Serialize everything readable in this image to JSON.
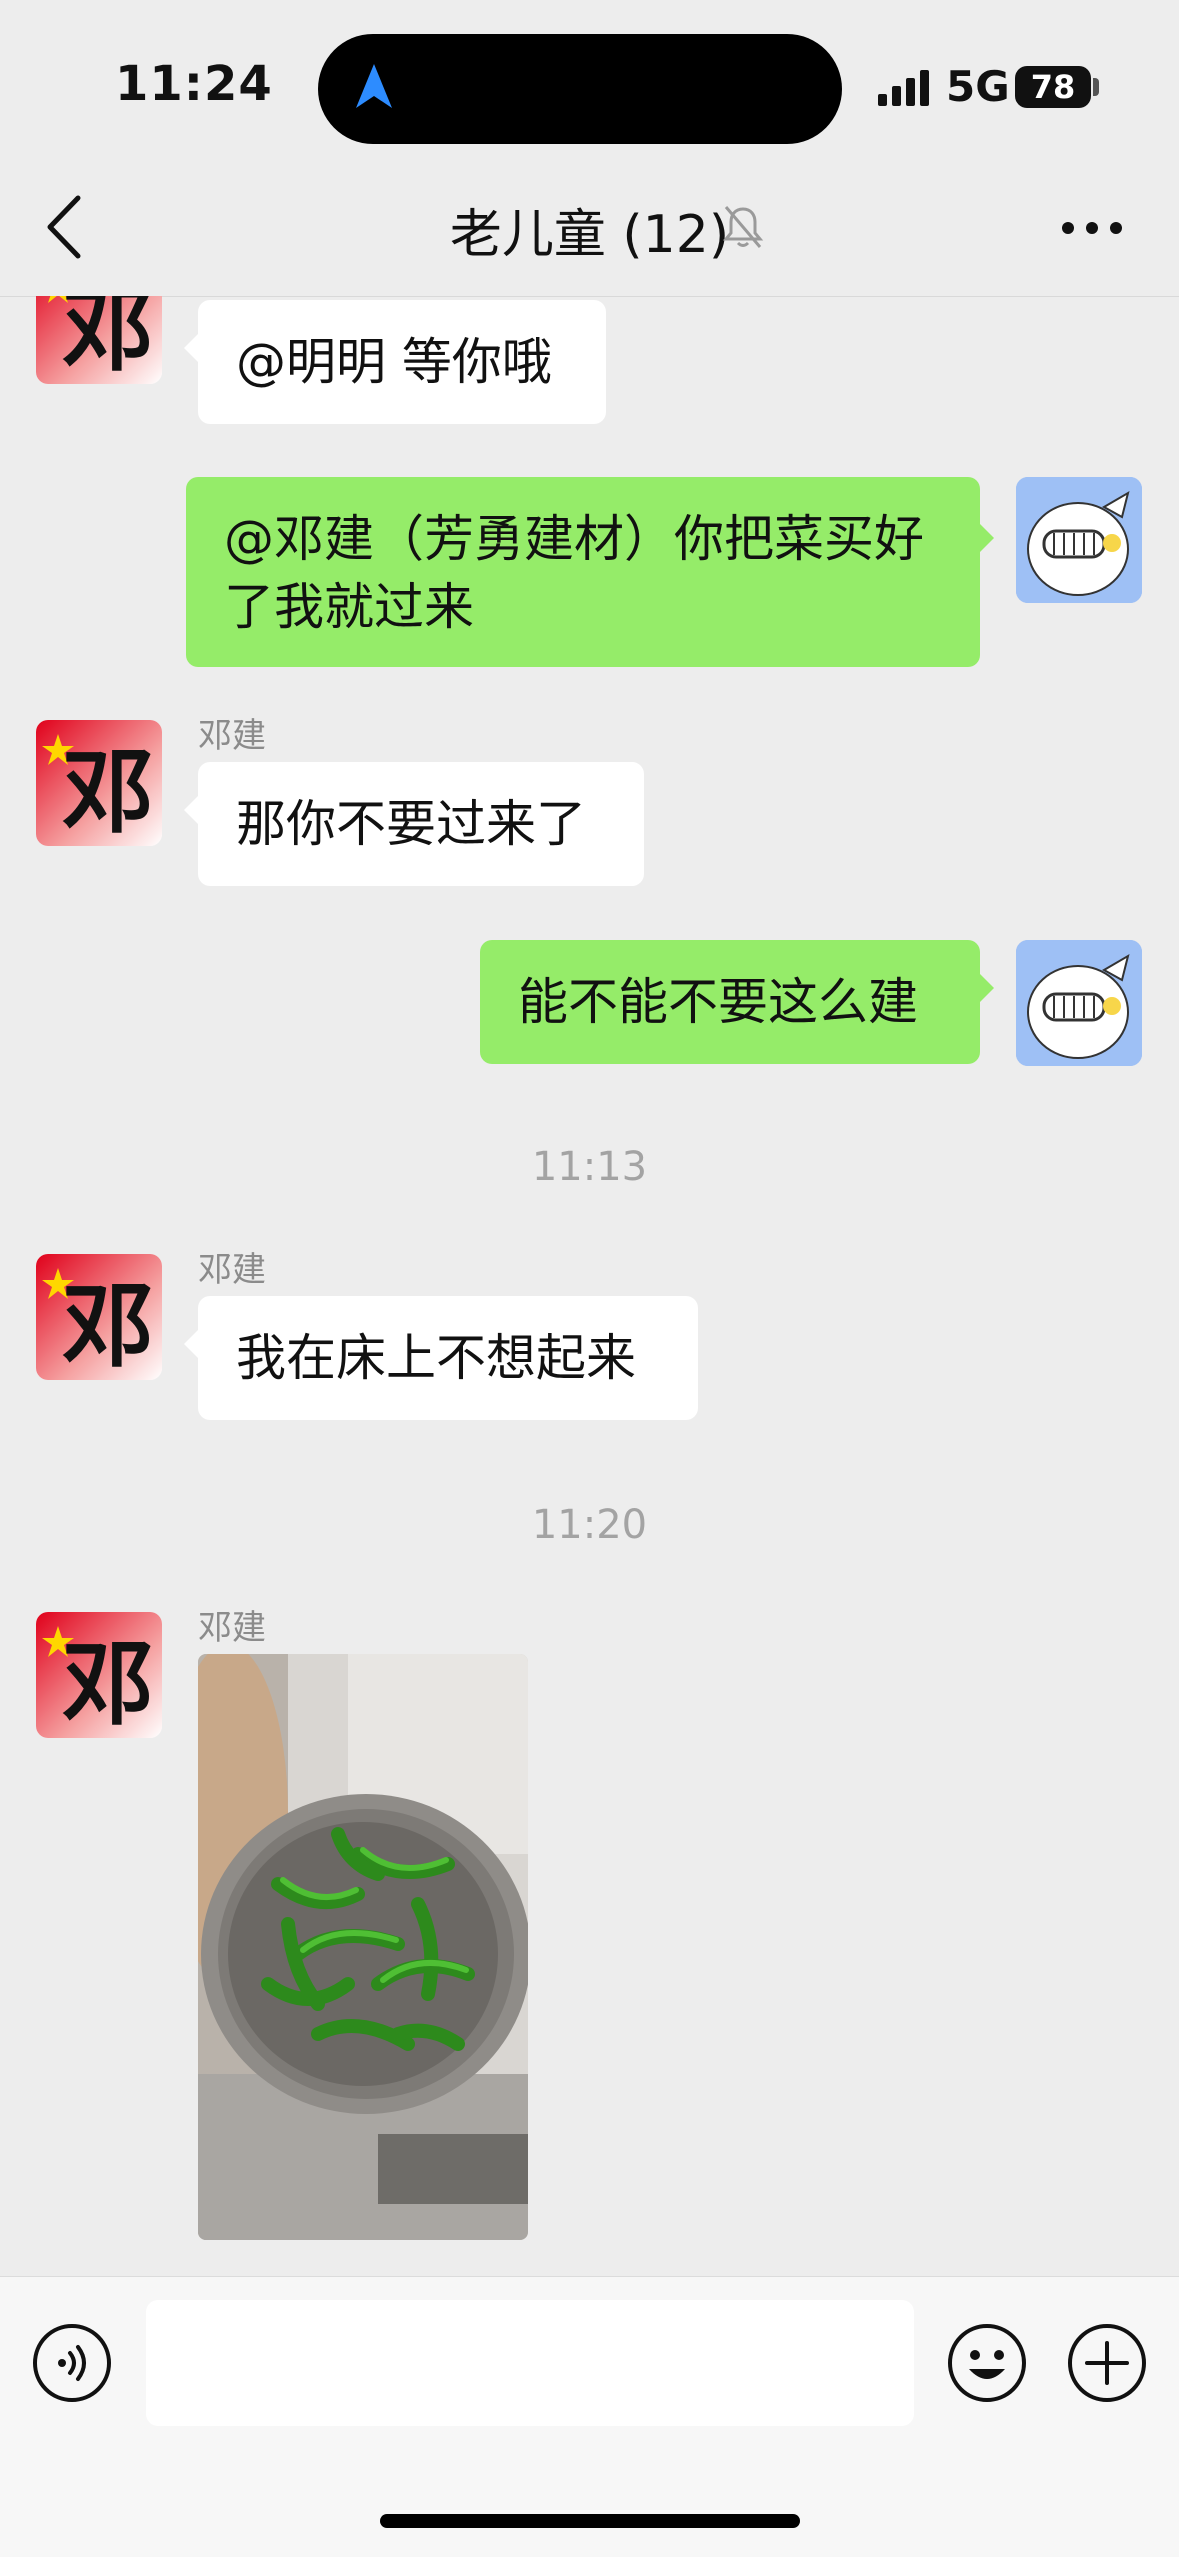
{
  "status_bar": {
    "time": "11:24",
    "network": "5G",
    "battery": "78",
    "icons": [
      "navigation-arrow-icon",
      "signal-icon",
      "battery-icon"
    ]
  },
  "header": {
    "title": "老儿童 (12)",
    "icons": [
      "back-chevron-icon",
      "mute-bell-icon",
      "more-dots-icon"
    ]
  },
  "messages": [
    {
      "direction": "in",
      "text": "@明明 等你哦"
    },
    {
      "direction": "out",
      "text": "@邓建（芳勇建材）你把菜买好\n了我就过来"
    },
    {
      "direction": "in",
      "sender": "邓建",
      "text": "那你不要过来了"
    },
    {
      "direction": "out",
      "text": "能不能不要这么建"
    },
    {
      "timestamp": "11:13"
    },
    {
      "direction": "in",
      "sender": "邓建",
      "text": "我在床上不想起来"
    },
    {
      "timestamp": "11:20"
    },
    {
      "direction": "in",
      "sender": "邓建",
      "image": "green-peppers-in-colander"
    }
  ],
  "avatars": {
    "peer_glyph": "邓",
    "peer": "flag-avatar",
    "self": "cartoon-avatar"
  },
  "input_bar": {
    "placeholder": "",
    "icons": [
      "voice-icon",
      "emoji-icon",
      "plus-icon"
    ]
  },
  "colors": {
    "background": "#ededed",
    "bubble_out": "#95ec69",
    "bubble_in": "#ffffff",
    "nav_arrow": "#1e90ff"
  }
}
